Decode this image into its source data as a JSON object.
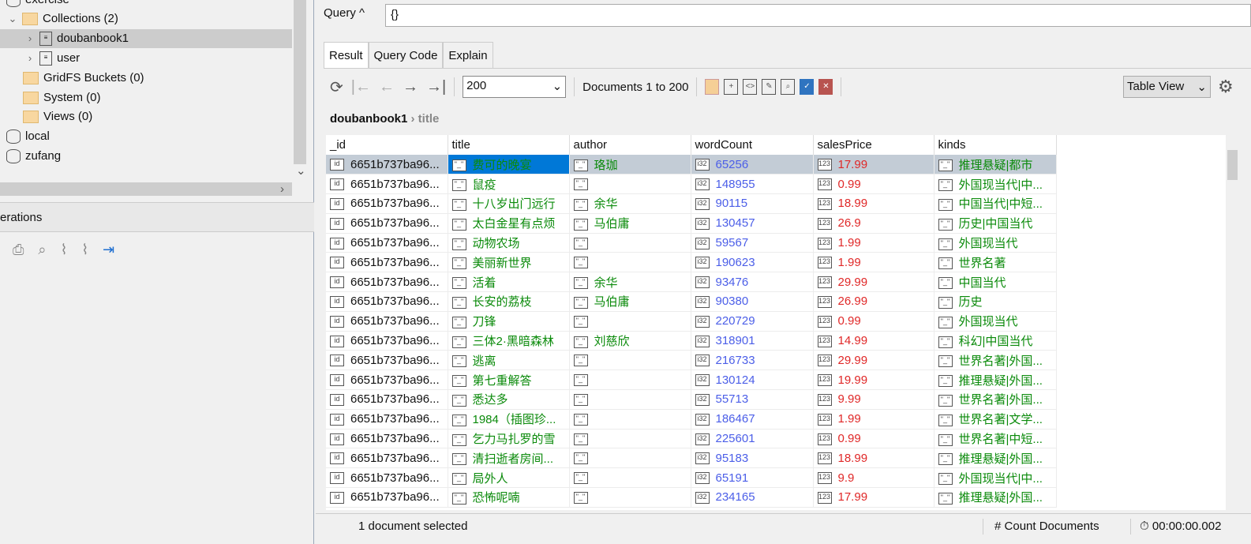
{
  "tree": {
    "items": [
      "exercise",
      "Collections (2)",
      "doubanbook1",
      "user",
      "GridFS Buckets (0)",
      "System (0)",
      "Views (0)",
      "local",
      "zufang"
    ]
  },
  "operations": {
    "title": "erations"
  },
  "query": {
    "label": "Query",
    "value": "{}"
  },
  "tabs": [
    "Result",
    "Query Code",
    "Explain"
  ],
  "toolbar": {
    "page_size": "200",
    "range": "Documents 1 to 200",
    "view": "Table View"
  },
  "breadcrumb": {
    "collection": "doubanbook1",
    "field": "title"
  },
  "table": {
    "columns": [
      "_id",
      "title",
      "author",
      "wordCount",
      "salesPrice",
      "kinds"
    ],
    "rows": [
      [
        "6651b737ba96...",
        "费可的晚宴",
        "珞珈",
        "65256",
        "17.99",
        "推理悬疑|都市"
      ],
      [
        "6651b737ba96...",
        "鼠疫",
        "",
        "148955",
        "0.99",
        "外国现当代|中..."
      ],
      [
        "6651b737ba96...",
        "十八岁出门远行",
        "余华",
        "90115",
        "18.99",
        "中国当代|中短..."
      ],
      [
        "6651b737ba96...",
        "太白金星有点烦",
        "马伯庸",
        "130457",
        "26.9",
        "历史|中国当代"
      ],
      [
        "6651b737ba96...",
        "动物农场",
        "",
        "59567",
        "1.99",
        "外国现当代"
      ],
      [
        "6651b737ba96...",
        "美丽新世界",
        "",
        "190623",
        "1.99",
        "世界名著"
      ],
      [
        "6651b737ba96...",
        "活着",
        "余华",
        "93476",
        "29.99",
        "中国当代"
      ],
      [
        "6651b737ba96...",
        "长安的荔枝",
        "马伯庸",
        "90380",
        "26.99",
        "历史"
      ],
      [
        "6651b737ba96...",
        "刀锋",
        "",
        "220729",
        "0.99",
        "外国现当代"
      ],
      [
        "6651b737ba96...",
        "三体2·黑暗森林",
        "刘慈欣",
        "318901",
        "14.99",
        "科幻|中国当代"
      ],
      [
        "6651b737ba96...",
        "逃离",
        "",
        "216733",
        "29.99",
        "世界名著|外国..."
      ],
      [
        "6651b737ba96...",
        "第七重解答",
        "",
        "130124",
        "19.99",
        "推理悬疑|外国..."
      ],
      [
        "6651b737ba96...",
        "悉达多",
        "",
        "55713",
        "9.99",
        "世界名著|外国..."
      ],
      [
        "6651b737ba96...",
        "1984（插图珍...",
        "",
        "186467",
        "1.99",
        "世界名著|文学..."
      ],
      [
        "6651b737ba96...",
        "乞力马扎罗的雪",
        "",
        "225601",
        "0.99",
        "世界名著|中短..."
      ],
      [
        "6651b737ba96...",
        "清扫逝者房间...",
        "",
        "95183",
        "18.99",
        "推理悬疑|外国..."
      ],
      [
        "6651b737ba96...",
        "局外人",
        "",
        "65191",
        "9.9",
        "外国现当代|中..."
      ],
      [
        "6651b737ba96...",
        "恐怖呢喃",
        "",
        "234165",
        "17.99",
        "推理悬疑|外国..."
      ]
    ]
  },
  "status": {
    "selected": "1 document selected",
    "count_button": "Count Documents",
    "timer": "00:00:00.002"
  }
}
